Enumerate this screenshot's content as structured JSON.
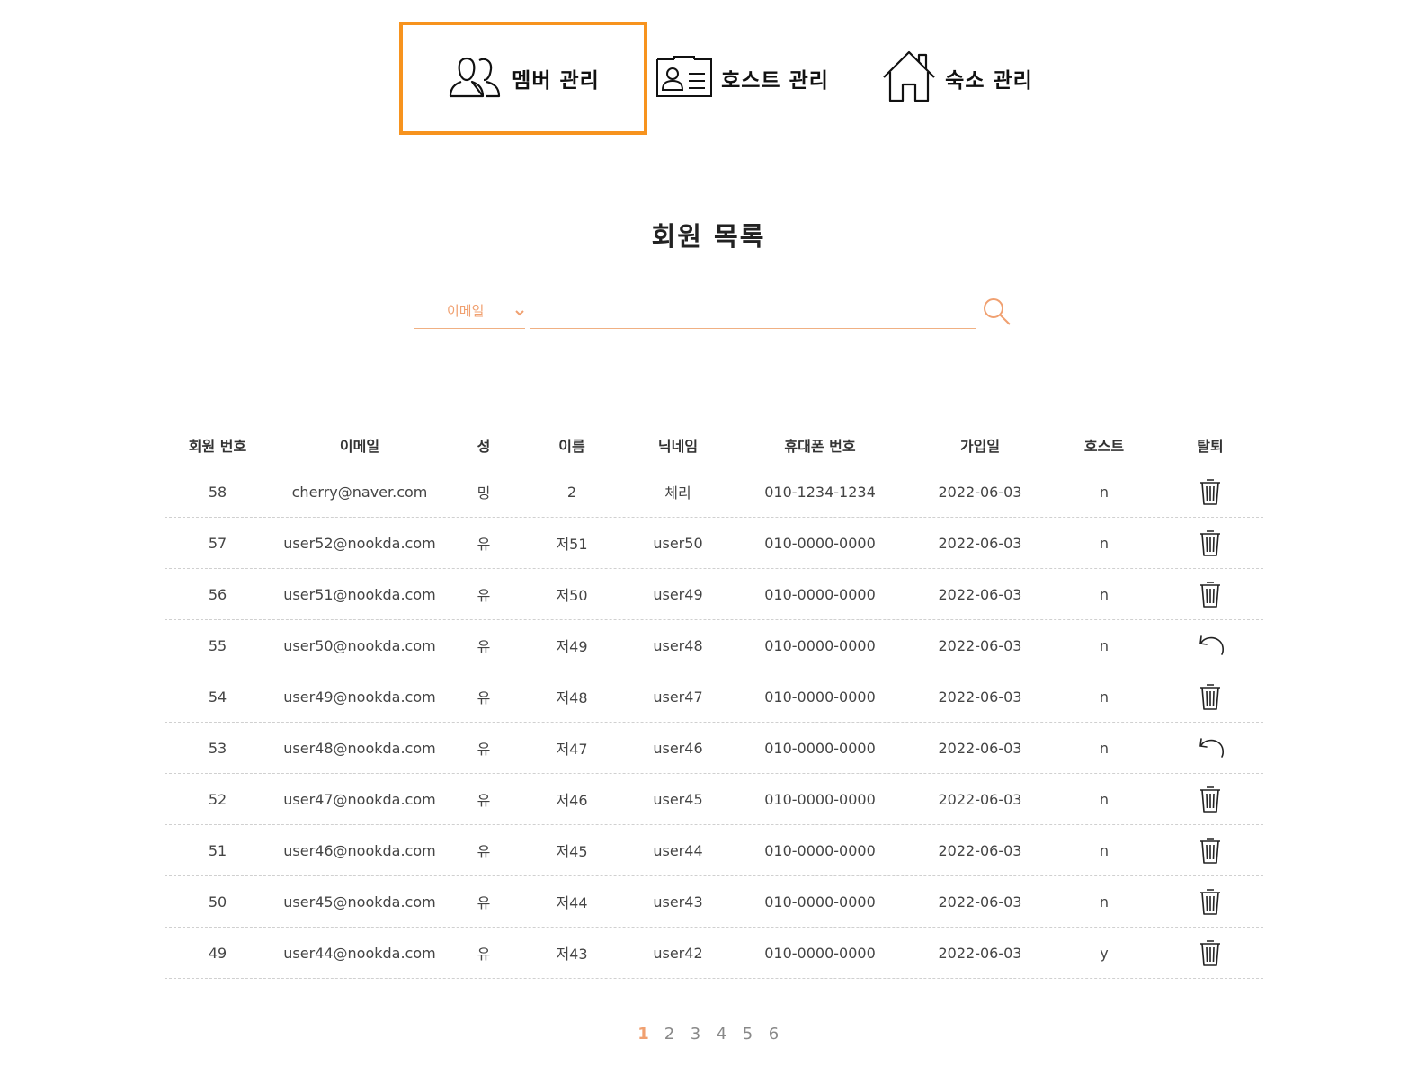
{
  "nav": {
    "tabs": [
      {
        "label": "멤버 관리",
        "icon": "people-icon",
        "active": true
      },
      {
        "label": "호스트 관리",
        "icon": "id-card-icon",
        "active": false
      },
      {
        "label": "숙소 관리",
        "icon": "house-icon",
        "active": false
      }
    ]
  },
  "page": {
    "title": "회원 목록"
  },
  "search": {
    "select_value": "이메일",
    "input_value": "",
    "icon": "search-icon"
  },
  "table": {
    "headers": [
      "회원 번호",
      "이메일",
      "성",
      "이름",
      "닉네임",
      "휴대폰 번호",
      "가입일",
      "호스트",
      "탈퇴"
    ],
    "rows": [
      {
        "id": "58",
        "email": "cherry@naver.com",
        "last": "밍",
        "first": "2",
        "nick": "체리",
        "phone": "010-1234-1234",
        "joined": "2022-06-03",
        "host": "n",
        "action": "trash-icon"
      },
      {
        "id": "57",
        "email": "user52@nookda.com",
        "last": "유",
        "first": "저51",
        "nick": "user50",
        "phone": "010-0000-0000",
        "joined": "2022-06-03",
        "host": "n",
        "action": "trash-icon"
      },
      {
        "id": "56",
        "email": "user51@nookda.com",
        "last": "유",
        "first": "저50",
        "nick": "user49",
        "phone": "010-0000-0000",
        "joined": "2022-06-03",
        "host": "n",
        "action": "trash-icon"
      },
      {
        "id": "55",
        "email": "user50@nookda.com",
        "last": "유",
        "first": "저49",
        "nick": "user48",
        "phone": "010-0000-0000",
        "joined": "2022-06-03",
        "host": "n",
        "action": "undo-icon"
      },
      {
        "id": "54",
        "email": "user49@nookda.com",
        "last": "유",
        "first": "저48",
        "nick": "user47",
        "phone": "010-0000-0000",
        "joined": "2022-06-03",
        "host": "n",
        "action": "trash-icon"
      },
      {
        "id": "53",
        "email": "user48@nookda.com",
        "last": "유",
        "first": "저47",
        "nick": "user46",
        "phone": "010-0000-0000",
        "joined": "2022-06-03",
        "host": "n",
        "action": "undo-icon"
      },
      {
        "id": "52",
        "email": "user47@nookda.com",
        "last": "유",
        "first": "저46",
        "nick": "user45",
        "phone": "010-0000-0000",
        "joined": "2022-06-03",
        "host": "n",
        "action": "trash-icon"
      },
      {
        "id": "51",
        "email": "user46@nookda.com",
        "last": "유",
        "first": "저45",
        "nick": "user44",
        "phone": "010-0000-0000",
        "joined": "2022-06-03",
        "host": "n",
        "action": "trash-icon"
      },
      {
        "id": "50",
        "email": "user45@nookda.com",
        "last": "유",
        "first": "저44",
        "nick": "user43",
        "phone": "010-0000-0000",
        "joined": "2022-06-03",
        "host": "n",
        "action": "trash-icon"
      },
      {
        "id": "49",
        "email": "user44@nookda.com",
        "last": "유",
        "first": "저43",
        "nick": "user42",
        "phone": "010-0000-0000",
        "joined": "2022-06-03",
        "host": "y",
        "action": "trash-icon"
      }
    ]
  },
  "pagination": {
    "current": "1",
    "pages": [
      "1",
      "2",
      "3",
      "4",
      "5",
      "6"
    ]
  },
  "colors": {
    "accent": "#f7931e",
    "search_accent": "#f0a070"
  }
}
